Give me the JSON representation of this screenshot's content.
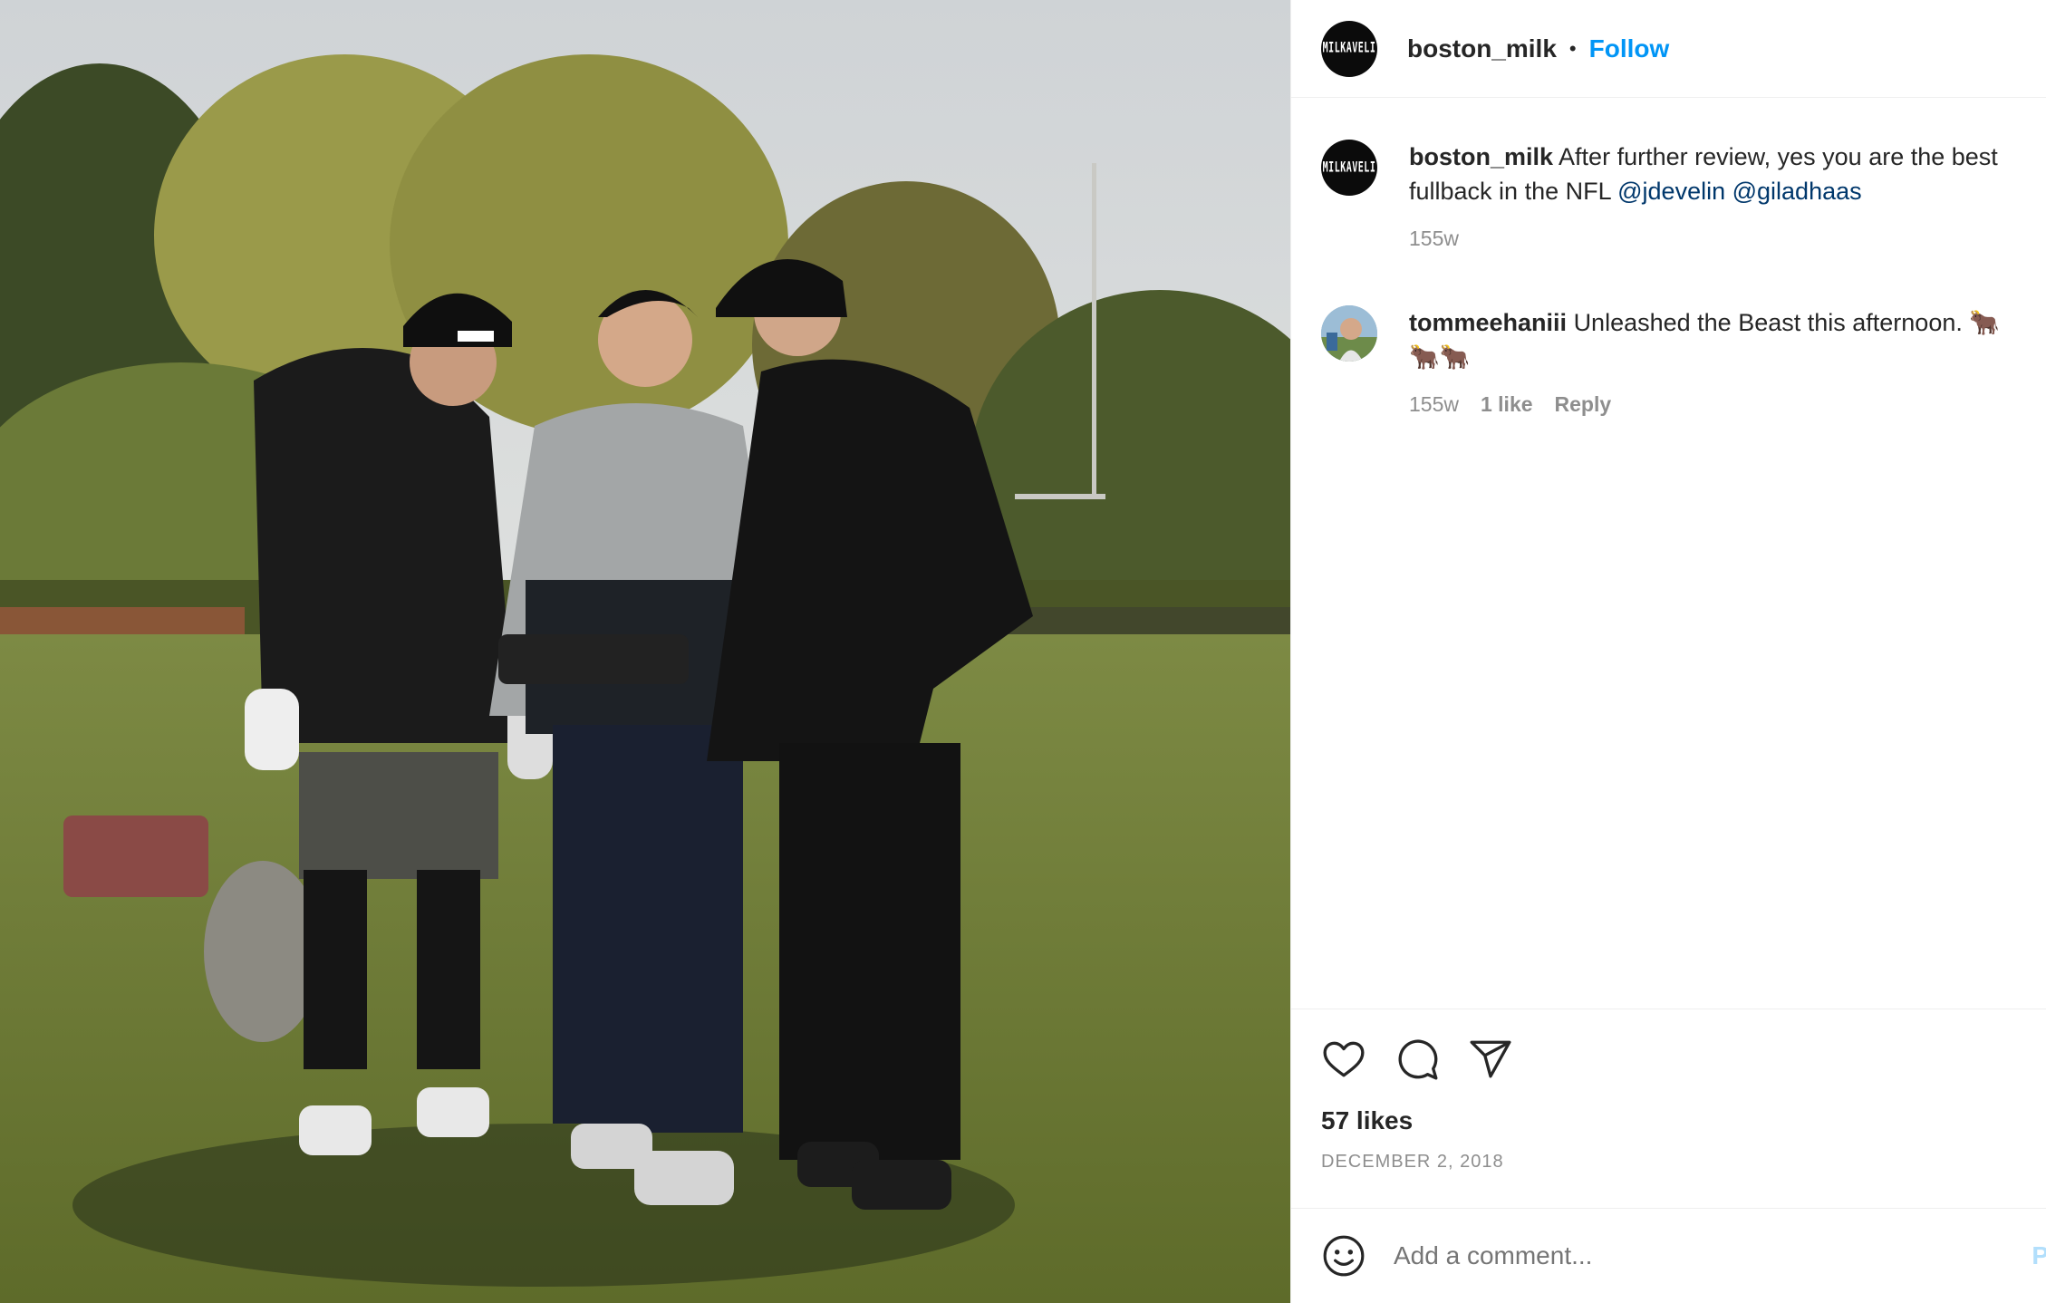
{
  "post": {
    "image_alt": "Three men on a football field looking at a camera gimbal controller"
  },
  "header": {
    "avatar_text": "MILKAVELI",
    "username": "boston_milk",
    "separator": "•",
    "follow_label": "Follow"
  },
  "caption": {
    "username": "boston_milk",
    "text": "After further review, yes you are the best fullback in the NFL",
    "mention_1": "@jdevelin",
    "mention_2": "@giladhaas",
    "age": "155w"
  },
  "comment": {
    "username": "tommeehaniii",
    "text": "Unleashed the Beast this afternoon. 🐂",
    "text_line2": "🐂🐂",
    "age": "155w",
    "likes": "1 like",
    "reply_label": "Reply"
  },
  "actions": {
    "like_icon": "heart-icon",
    "comment_icon": "comment-bubble-icon",
    "share_icon": "paper-plane-icon",
    "likes_count": "57 likes",
    "date": "DECEMBER 2, 2018"
  },
  "add_comment": {
    "emoji_icon": "smiley-icon",
    "placeholder": "Add a comment...",
    "post_label": "P"
  },
  "colors": {
    "link_blue": "#0095f6",
    "mention_blue": "#00376b",
    "muted_gray": "#8e8e8e",
    "text": "#262626"
  }
}
